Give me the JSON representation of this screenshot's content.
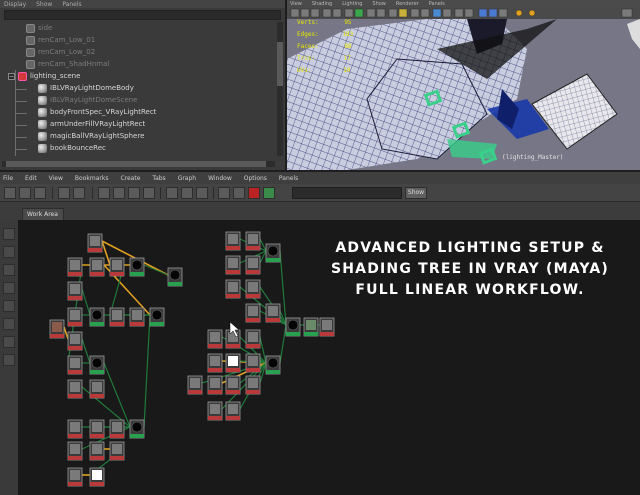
{
  "outliner": {
    "menu": [
      "Display",
      "Show",
      "Panels"
    ],
    "items": [
      {
        "label": "side",
        "icon": "camera-icon",
        "dim": true
      },
      {
        "label": "renCam_Low_01",
        "icon": "camera-icon",
        "dim": true
      },
      {
        "label": "renCam_Low_02",
        "icon": "camera-icon",
        "dim": true
      },
      {
        "label": "renCam_ShadHnmal",
        "icon": "camera-icon",
        "dim": true
      },
      {
        "label": "lighting_scene",
        "icon": "group-icon",
        "dim": false
      },
      {
        "label": "IBLVRayLightDomeBody",
        "icon": "light-icon",
        "dim": false
      },
      {
        "label": "IBLVRayLightDomeScene",
        "icon": "light-icon",
        "dim": true
      },
      {
        "label": "bodyFrontSpec_VRayLightRect",
        "icon": "light-icon",
        "dim": false
      },
      {
        "label": "armUnderFillVRayLightRect",
        "icon": "light-icon",
        "dim": false
      },
      {
        "label": "magicBallVRayLightSphere",
        "icon": "light-icon",
        "dim": false
      },
      {
        "label": "bookBounceRec",
        "icon": "light-icon",
        "dim": false
      }
    ]
  },
  "viewport": {
    "menu": [
      "View",
      "Shading",
      "Lighting",
      "Show",
      "Renderer",
      "Panels"
    ],
    "hud": {
      "rows": [
        {
          "label": "Verts:",
          "value": "95"
        },
        {
          "label": "Edges:",
          "value": "183"
        },
        {
          "label": "Faces:",
          "value": "88"
        },
        {
          "label": "Tris:",
          "value": "17"
        },
        {
          "label": "UVs:",
          "value": "10"
        }
      ]
    },
    "camera_label": "(lighting_Master)"
  },
  "hypershade": {
    "menu": [
      "File",
      "Edit",
      "View",
      "Bookmarks",
      "Create",
      "Tabs",
      "Graph",
      "Window",
      "Options",
      "Panels"
    ],
    "search_value": "",
    "show_label": "Show",
    "tab_label": "Work Area"
  },
  "overlay": {
    "line1": "Advanced Lighting Setup &",
    "line2": "Shading Tree in VRay (Maya)",
    "line3": "Full Linear Workflow."
  },
  "colors": {
    "connection_green": "#1f7a3a",
    "connection_orange": "#e0a020",
    "node_frame": "#9a9a9a",
    "node_label_red": "#b83a3a",
    "node_label_green": "#28a050"
  }
}
